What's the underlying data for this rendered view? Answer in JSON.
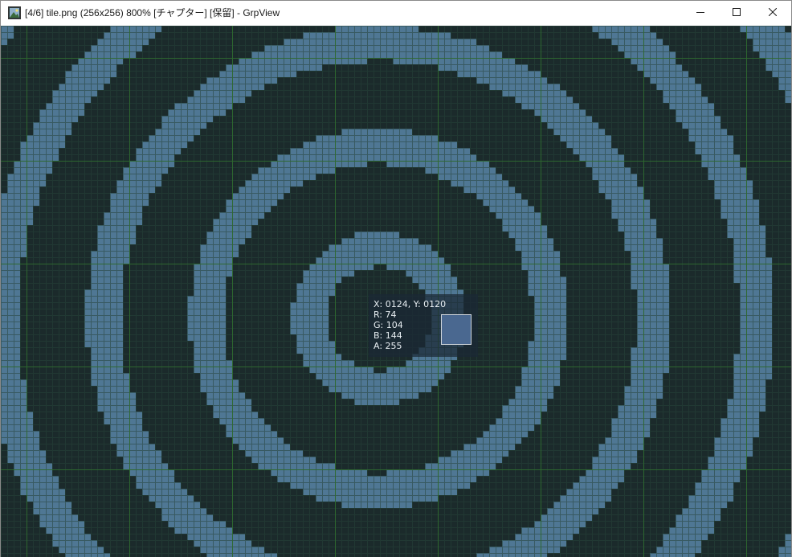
{
  "window": {
    "title": "[4/6] tile.png (256x256) 800% [チャプター] [保留] - GrpView",
    "app_icon": "image-viewer-icon",
    "controls": {
      "minimize_icon": "minimize-icon",
      "maximize_icon": "maximize-icon",
      "close_icon": "close-icon"
    }
  },
  "viewer": {
    "image_name": "tile.png",
    "image_size": "256x256",
    "zoom": "800%",
    "position": "4/6",
    "pixel_grid": true,
    "colors": {
      "background": "#1b2a2b",
      "ring": "#4f7794",
      "grid": "#26443a",
      "major_grid": "#2f6b2f"
    }
  },
  "pixel_info": {
    "coords": "X: 0124, Y: 0120",
    "r": "R: 74",
    "g": "G: 104",
    "b": "B: 144",
    "a": "A: 255",
    "swatch_color": "#4a6890"
  }
}
